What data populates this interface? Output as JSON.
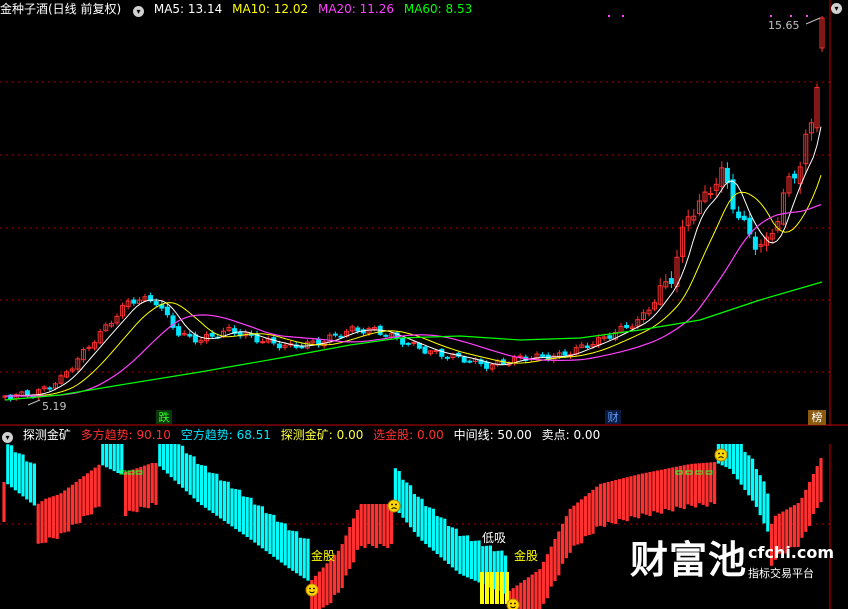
{
  "main_header": {
    "stock": "金种子酒(日线 前复权)",
    "ma5": "MA5: 13.14",
    "ma10": "MA10: 12.02",
    "ma20": "MA20: 11.26",
    "ma60": "MA60: 8.53"
  },
  "ind_header": {
    "name": "探测金矿",
    "bull": "多方趋势: 90.10",
    "bear": "空方趋势: 68.51",
    "mine": "探测金矿: 0.00",
    "pick": "选金股: 0.00",
    "mid": "中间线: 50.00",
    "sell": "卖点: 0.00"
  },
  "main_labels": {
    "high": "15.65",
    "low": "5.19",
    "m1": "跌",
    "m2": "财",
    "m3": "榜"
  },
  "ind_labels": {
    "jin1": "金股",
    "dixi": "低吸",
    "jin2": "金股"
  },
  "watermark": {
    "big": "财富池",
    "domain": "cfchi.com",
    "sub": "指标交易平台"
  },
  "colors": {
    "up": "#ff3030",
    "down": "#00e5ff",
    "ma5": "#ffffff",
    "ma10": "#ffff00",
    "ma20": "#ff40ff",
    "ma60": "#00ff00",
    "bull": "#ff3030",
    "bear": "#00ffff",
    "buy": "#ffff00",
    "gold": "#ffff00"
  },
  "chart_data": [
    {
      "type": "candlestick",
      "title": "金种子酒(日线 前复权)",
      "price_range": [
        5.19,
        15.65
      ],
      "highest_label": 15.65,
      "lowest_label": 5.19,
      "ma_latest": {
        "MA5": 13.14,
        "MA10": 12.02,
        "MA20": 11.26,
        "MA60": 8.53
      },
      "series_trend_keypoints": [
        {
          "name": "close",
          "values": [
            5.3,
            5.4,
            6.2,
            7.6,
            8.2,
            7.0,
            6.9,
            7.2,
            7.0,
            7.3,
            6.6,
            6.5,
            6.5,
            7.0,
            6.8,
            8.8,
            11.5,
            10.0,
            10.4,
            9.2,
            11.9,
            13.3,
            15.6
          ]
        }
      ]
    },
    {
      "type": "bar",
      "title": "探测金矿",
      "ylim": [
        0,
        100
      ],
      "mid_line": 50.0,
      "latest": {
        "多方趋势": 90.1,
        "空方趋势": 68.51,
        "探测金矿": 0.0,
        "选金股": 0.0,
        "中间线": 50.0,
        "卖点": 0.0
      }
    }
  ]
}
